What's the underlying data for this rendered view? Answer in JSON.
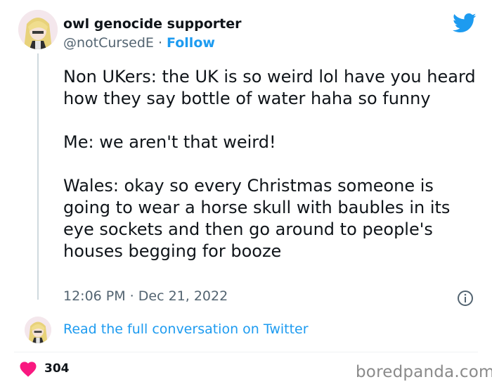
{
  "author": {
    "display_name": "owl genocide supporter",
    "handle": "@notCursedE",
    "separator": "·",
    "follow_label": "Follow"
  },
  "tweet": {
    "paragraphs": [
      "Non UKers: the UK is so weird lol have you heard how they say bottle of water haha so funny",
      "Me: we aren't that weird!",
      "Wales: okay so every Christmas someone is going to wear a horse skull with baubles in its eye sockets and then go around to people's houses begging for booze"
    ],
    "timestamp": "12:06 PM · Dec 21, 2022"
  },
  "conversation": {
    "link_label": "Read the full conversation on Twitter"
  },
  "engagement": {
    "like_count": "304"
  },
  "watermark": "boredpanda.com",
  "colors": {
    "twitter_blue": "#1d9bf0",
    "heart_pink": "#f91880",
    "secondary_text": "#536471"
  },
  "icons": {
    "brand": "twitter-bird-icon",
    "info": "info-icon",
    "like": "heart-icon"
  }
}
